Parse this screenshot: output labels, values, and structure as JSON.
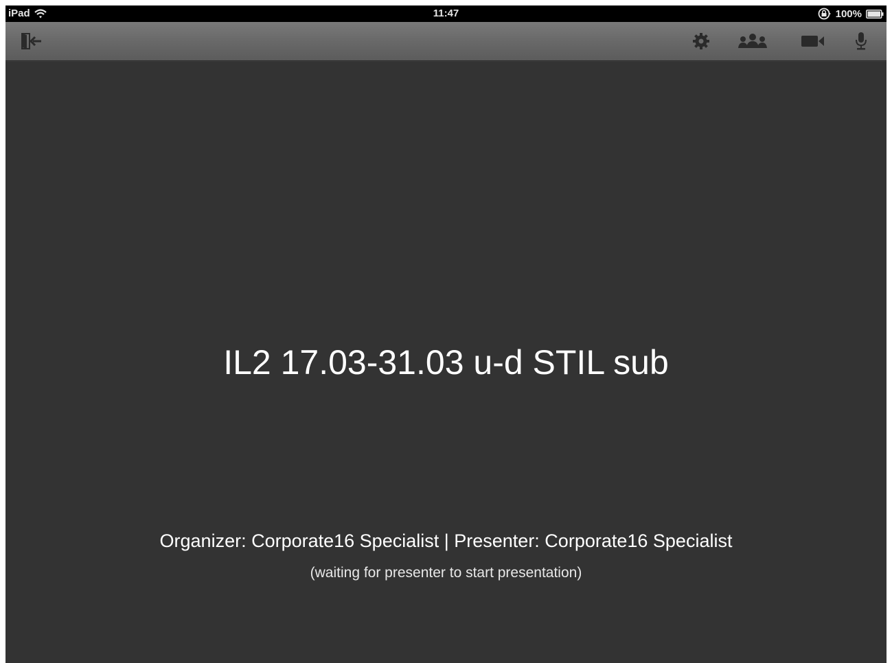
{
  "status_bar": {
    "device": "iPad",
    "time": "11:47",
    "battery": "100%",
    "icons": [
      "wifi-icon",
      "rotation-lock-icon",
      "battery-icon"
    ]
  },
  "toolbar": {
    "buttons": [
      {
        "name": "leave-meeting",
        "icon": "exit-door-icon"
      },
      {
        "name": "settings",
        "icon": "gear-icon"
      },
      {
        "name": "participants",
        "icon": "people-icon"
      },
      {
        "name": "video",
        "icon": "video-camera-icon"
      },
      {
        "name": "microphone",
        "icon": "microphone-icon"
      }
    ]
  },
  "meeting": {
    "title": "IL2 17.03-31.03 u-d STIL sub",
    "info": "Organizer: Corporate16 Specialist | Presenter: Corporate16 Specialist",
    "status": "(waiting for presenter to start presentation)"
  },
  "colors": {
    "background": "#333333",
    "status_bar": "#000000",
    "toolbar": "#6a6a6a",
    "icon": "#2a2a2a",
    "text": "#ffffff"
  }
}
